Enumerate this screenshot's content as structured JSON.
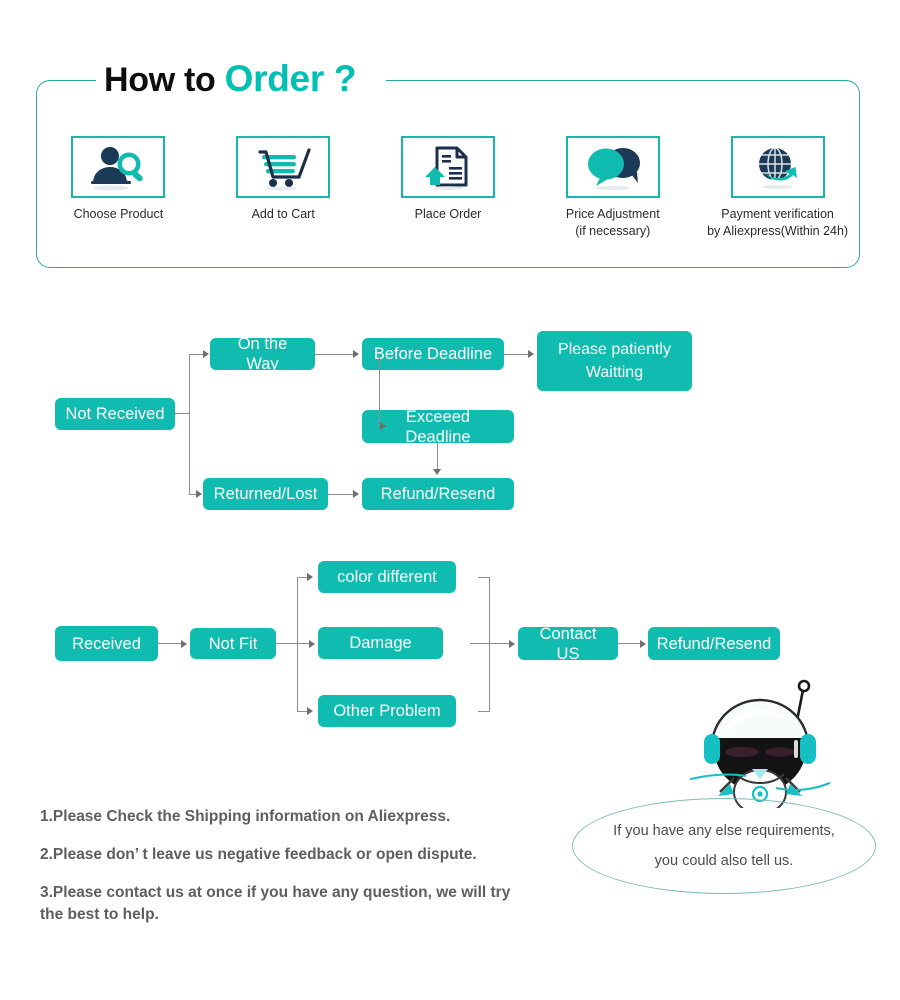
{
  "header": {
    "title_part1": "How to ",
    "title_part2": "Order ?",
    "accent_color": "#00bfb3",
    "border_color": "#2aa9a0"
  },
  "steps": [
    {
      "icon": "person-search-icon",
      "label_line1": "Choose  Product",
      "label_line2": ""
    },
    {
      "icon": "shopping-cart-icon",
      "label_line1": "Add to Cart",
      "label_line2": ""
    },
    {
      "icon": "document-upload-icon",
      "label_line1": "Place  Order",
      "label_line2": ""
    },
    {
      "icon": "speech-bubbles-icon",
      "label_line1": "Price Adjustment",
      "label_line2": "(if necessary)"
    },
    {
      "icon": "globe-arrow-icon",
      "label_line1": "Payment verification",
      "label_line2": "by Aliexpress(Within 24h)"
    }
  ],
  "flow_not_received": {
    "box_color": "#0fbcaf",
    "connector_color": "#8d8d8d",
    "nodes": {
      "start": "Not Received",
      "on_the_way": "On the Way",
      "before_deadline": "Before Deadline",
      "please_wait_line1": "Please patiently",
      "please_wait_line2": "Waitting",
      "exceed_deadline": "Exceeed Deadline",
      "returned_lost": "Returned/Lost",
      "refund_resend": "Refund/Resend"
    }
  },
  "flow_received": {
    "box_color": "#0fbcaf",
    "connector_color": "#8d8d8d",
    "nodes": {
      "start": "Received",
      "not_fit": "Not Fit",
      "color_different": "color different",
      "damage": "Damage",
      "other_problem": "Other Problem",
      "contact_us": "Contact US",
      "refund_resend": "Refund/Resend"
    }
  },
  "notes": [
    {
      "text": "1.Please Check the Shipping information on Aliexpress.",
      "cont": ""
    },
    {
      "text": "2.Please don’ t leave us negative feedback or open dispute.",
      "cont": ""
    },
    {
      "text": "3.Please contact us at once if you have any question, we will try",
      "cont": " the best to help."
    }
  ],
  "speech_bubble": {
    "line1": "If you have any else requirements,",
    "line2": "you could also tell us.",
    "border_color": "#7fbcb8"
  },
  "mascot": {
    "name": "astronaut-mascot"
  }
}
